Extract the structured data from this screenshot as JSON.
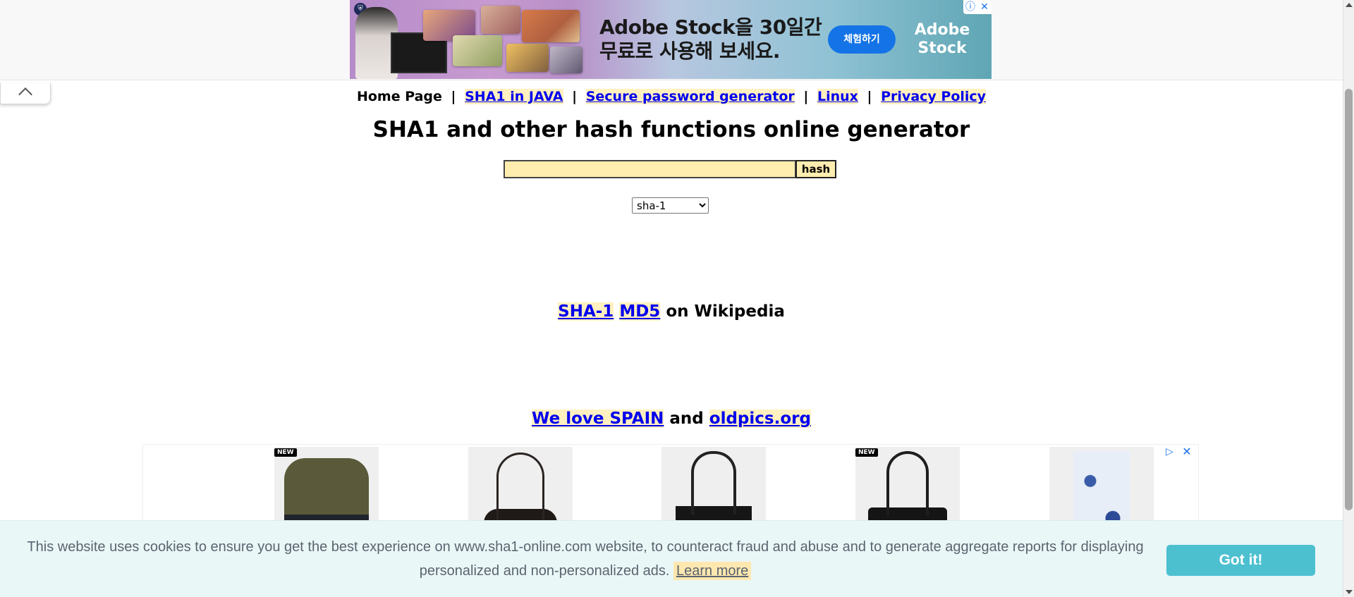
{
  "ad_banner": {
    "headline_line1": "Adobe Stock을 30일간",
    "headline_line2": "무료로 사용해 보세요.",
    "cta_label": "체험하기",
    "brand_line1": "Adobe",
    "brand_line2": "Stock"
  },
  "nav": {
    "home": "Home Page",
    "separator": "|",
    "links": [
      "SHA1 in JAVA",
      "Secure password generator",
      "Linux",
      "Privacy Policy"
    ]
  },
  "main": {
    "title": "SHA1 and other hash functions online generator",
    "input_value": "",
    "hash_button": "hash",
    "algorithm_selected": "sha-1"
  },
  "wiki": {
    "link1": "SHA-1",
    "link2": "MD5",
    "suffix": "on Wikipedia"
  },
  "love": {
    "link1": "We love SPAIN",
    "and": "and",
    "link2": "oldpics.org"
  },
  "product_ad": {
    "badges": [
      "NEW",
      "NEW"
    ]
  },
  "cookie": {
    "text": "This website uses cookies to ensure you get the best experience on www.sha1-online.com website, to counteract fraud and abuse and to generate aggregate reports for displaying personalized and non-personalized ads.",
    "learn_more": "Learn more",
    "button": "Got it!"
  },
  "colors": {
    "link": "#0000ee",
    "link_highlight": "#fff0c0",
    "input_bg": "#ffedb0",
    "cookie_bg": "#eaf7f7",
    "cookie_button": "#4dc0d0",
    "ad_cta": "#1473e6"
  }
}
